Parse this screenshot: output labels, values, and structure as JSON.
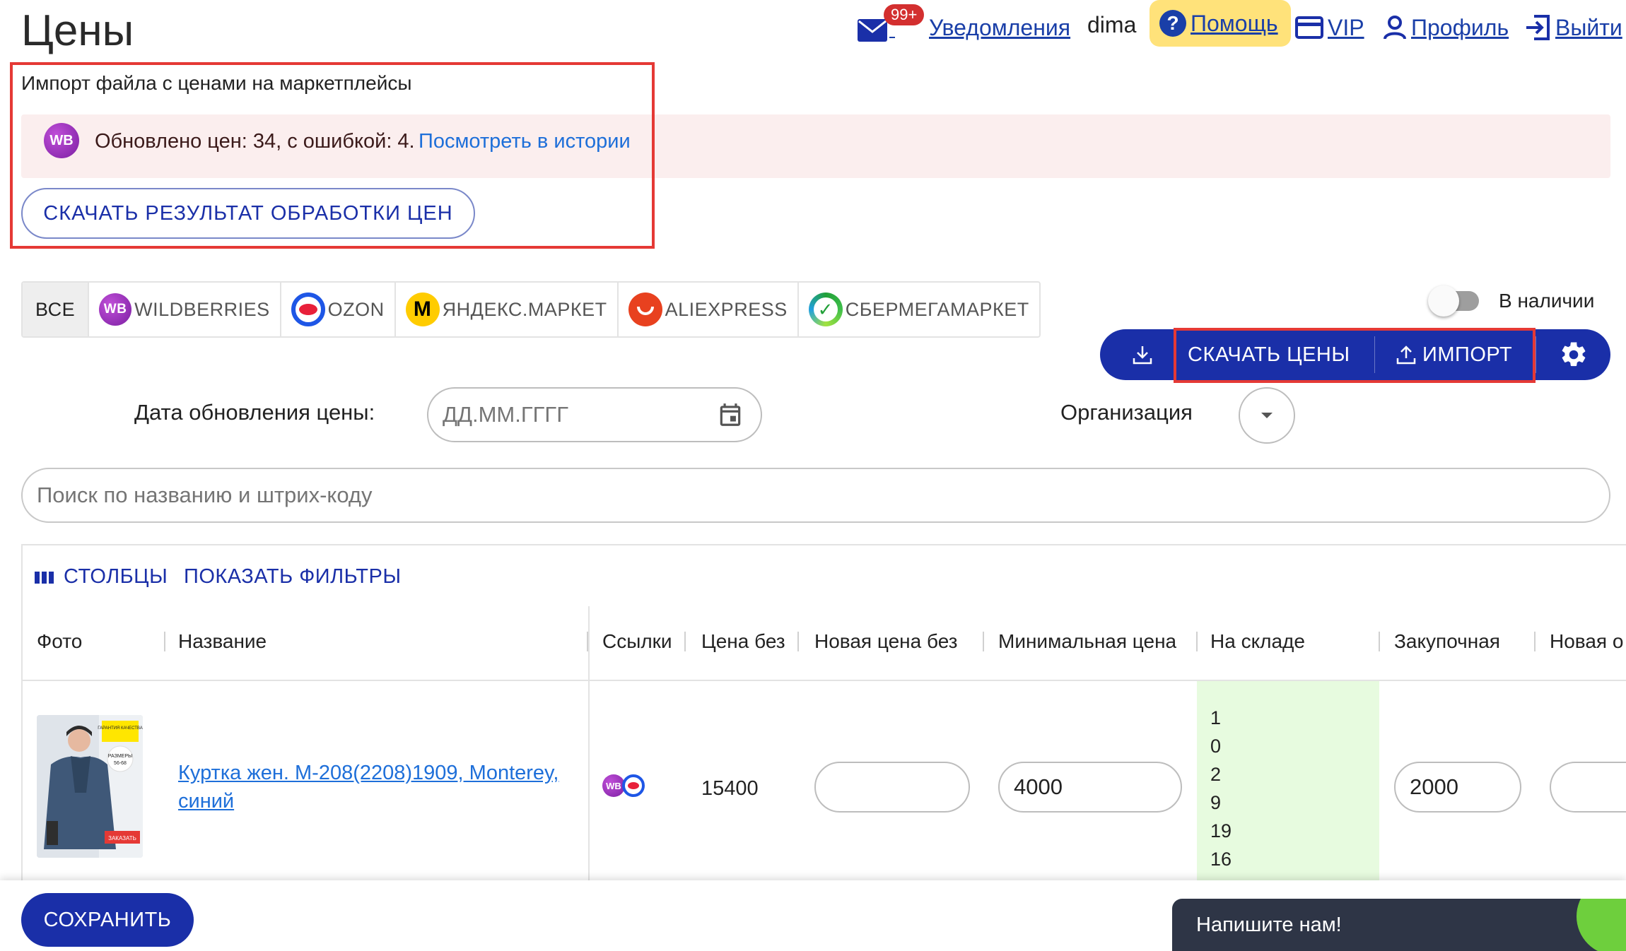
{
  "page": {
    "title": "Цены"
  },
  "topnav": {
    "badge": "99+",
    "notifications": "Уведомления",
    "username": "dima",
    "help": "Помощь",
    "vip": "VIP",
    "profile": "Профиль",
    "logout": "Выйти"
  },
  "import_box": {
    "title": "Импорт файла с ценами на маркетплейсы",
    "alert_text": "Обновлено цен: 34, с ошибкой: 4.",
    "alert_link": "Посмотреть в истории",
    "download_result_button": "СКАЧАТЬ РЕЗУЛЬТАТ ОБРАБОТКИ ЦЕН"
  },
  "marketplace_tabs": [
    {
      "label": "ВСЕ",
      "active": true
    },
    {
      "label": "WILDBERRIES",
      "logo": "WB"
    },
    {
      "label": "OZON"
    },
    {
      "label": "ЯНДЕКС.МАРКЕТ",
      "logo": "М"
    },
    {
      "label": "ALIEXPRESS"
    },
    {
      "label": "СБЕРМЕГАМАРКЕТ"
    }
  ],
  "in_stock_toggle": {
    "label": "В наличии",
    "on": false
  },
  "actions": {
    "download_prices": "СКАЧАТЬ ЦЕНЫ",
    "import": "ИМПОРТ"
  },
  "filters": {
    "date_label": "Дата обновления цены:",
    "date_placeholder": "ДД.ММ.ГГГГ",
    "org_label": "Организация",
    "search_placeholder": "Поиск по названию и штрих-коду"
  },
  "table": {
    "columns_button": "СТОЛБЦЫ",
    "filters_button": "ПОКАЗАТЬ ФИЛЬТРЫ",
    "headers": [
      "Фото",
      "Название",
      "Ссылки",
      "Цена без",
      "Новая цена без",
      "Минимальная цена",
      "На складе",
      "Закупочная",
      "Новая о"
    ],
    "rows": [
      {
        "name": "Куртка жен. М-208(2208)1909, Monterey, синий",
        "link_logo": "WB",
        "price": "15400",
        "new_price": "",
        "min_price": "4000",
        "stock": [
          "1",
          "0",
          "2",
          "9",
          "19",
          "16"
        ],
        "purchase": "2000",
        "photo_text": {
          "guarantee": "ГАРАНТИЯ КАЧЕСТВА",
          "sizes": "РАЗМЕРЫ",
          "range": "56-68",
          "order": "ЗАКАЗАТЬ"
        }
      }
    ]
  },
  "bottom": {
    "save_button": "СОХРАНИТЬ",
    "chat_text": "Напишите нам!"
  },
  "colors": {
    "primary": "#1a2fa8",
    "highlight_border": "#e53935",
    "alert_bg": "#fbeeee",
    "help_bg": "#ffe27a",
    "stock_bg": "#e7fbdf",
    "link": "#1e6fd9"
  },
  "icons": [
    "mail-icon",
    "help-icon",
    "vip-card-icon",
    "profile-icon",
    "logout-icon",
    "download-icon",
    "upload-icon",
    "gear-icon",
    "calendar-icon",
    "chevron-down-icon",
    "columns-icon"
  ]
}
